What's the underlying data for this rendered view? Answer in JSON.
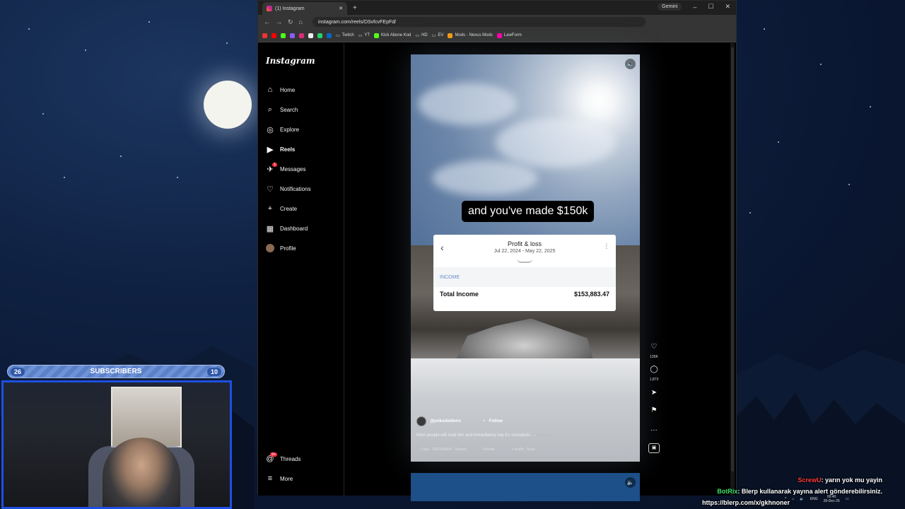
{
  "browser": {
    "tab_title": "(1) Instagram",
    "new_tab": "+",
    "gemini_label": "Gemini",
    "url": "instagram.com/reels/DSvfcvFEpFd/",
    "bookmarks": [
      "Twitch",
      "YT",
      "Kick Abone Kod",
      "HD",
      "EV",
      "Mods - Nexus Mods",
      "LawForm"
    ]
  },
  "instagram": {
    "logo": "Instagram",
    "nav": [
      {
        "label": "Home",
        "icon": "home-icon"
      },
      {
        "label": "Search",
        "icon": "search-icon"
      },
      {
        "label": "Explore",
        "icon": "compass-icon"
      },
      {
        "label": "Reels",
        "icon": "reels-icon"
      },
      {
        "label": "Messages",
        "icon": "messenger-icon",
        "badge": "1"
      },
      {
        "label": "Notifications",
        "icon": "heart-icon"
      },
      {
        "label": "Create",
        "icon": "plus-icon"
      },
      {
        "label": "Dashboard",
        "icon": "dashboard-icon"
      },
      {
        "label": "Profile",
        "icon": "avatar-icon"
      }
    ],
    "threads": {
      "label": "Threads",
      "badge": "9+"
    },
    "more": {
      "label": "More"
    }
  },
  "reel": {
    "overlay_caption": "and you've made $150k",
    "card": {
      "title": "Profit & loss",
      "dates": "Jul 22, 2024 - May 22, 2025",
      "section": "INCOME",
      "row_label": "Total Income",
      "row_value": "$153,883.47"
    },
    "username": "jtjunksolutions",
    "follow": "Follow",
    "description": "Most people will read this and immediately say it's unrealistic. ...",
    "more_link": "more",
    "audio": "Figo · INSONAMIA - Slowed",
    "tagged": "Ronald",
    "location": "Austin, Texas",
    "likes": "135K",
    "comments": "1,873"
  },
  "stream": {
    "subscribers_label": "SUBSCRIBERS",
    "sub_left": "26",
    "sub_right": "10",
    "chat": [
      {
        "user": "ScrewU",
        "text": ": yarın yok mu yayin",
        "color": "#ff3b3b"
      },
      {
        "user": "BotRix",
        "text": ": Blerp kullanarak yayına alert gönderebilirsiniz.",
        "color": "#3fe46b"
      },
      {
        "user": "",
        "text": "https://blerp.com/x/gkhnoner",
        "color": "#ffffff"
      }
    ]
  },
  "taskbar": {
    "lang": "ENG",
    "time": "00:40",
    "date": "28-Dec-25"
  }
}
